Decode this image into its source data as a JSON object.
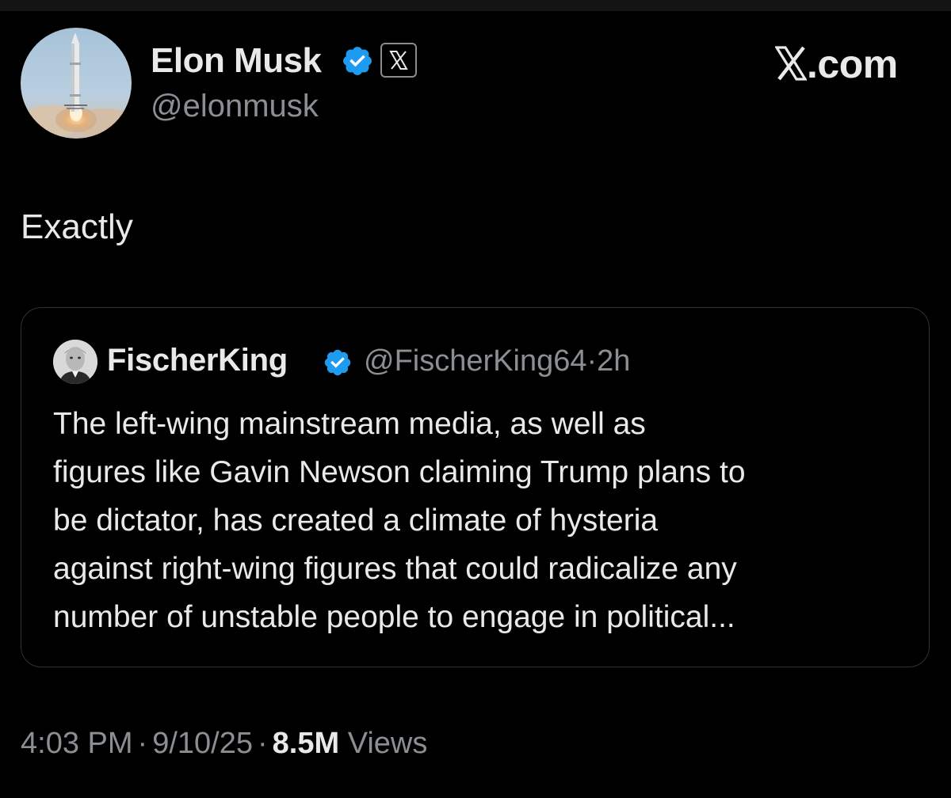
{
  "author": {
    "name": "Elon Musk",
    "handle": "@elonmusk",
    "avatar_icon": "rocket-launch-avatar",
    "verified_icon": "blue-verified-check-icon",
    "affiliate_icon": "x-logo-badge-icon"
  },
  "brand": {
    "label": ".com",
    "glyph_icon": "x-logo-icon"
  },
  "tweet": {
    "text": "Exactly"
  },
  "quoted_tweet": {
    "name": "FischerKing",
    "handle": "@FischerKing64",
    "separator": "·",
    "age": "2h",
    "avatar_icon": "portrait-avatar",
    "verified_icon": "blue-verified-check-icon",
    "lines": [
      "The left-wing mainstream media, as well as",
      "figures like Gavin Newson claiming Trump plans to",
      "be dictator, has created a climate of hysteria",
      "against right-wing figures that could radicalize any",
      "number of unstable people to engage in political..."
    ]
  },
  "footer": {
    "time": "4:03 PM",
    "separator": "·",
    "date": "9/10/25",
    "views_count": "8.5M",
    "views_label": "Views"
  },
  "colors": {
    "background": "#000000",
    "text_primary": "#e7e9ea",
    "text_secondary": "#8b8f94",
    "verified_blue": "#1d9bf0",
    "card_border": "#2f3336"
  }
}
